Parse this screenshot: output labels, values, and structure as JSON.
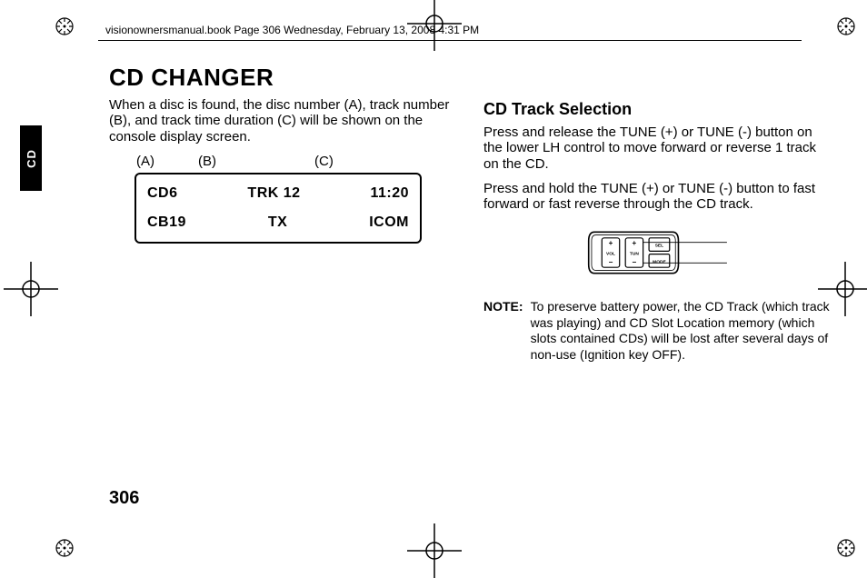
{
  "header": "visionownersmanual.book  Page 306  Wednesday, February 13, 2008  4:31 PM",
  "side_tab": "CD",
  "page_number": "306",
  "col1": {
    "title": "CD CHANGER",
    "intro": "When a disc is found, the disc number (A), track number (B), and track time duration (C) will be shown on the console display screen.",
    "labels": {
      "a": "(A)",
      "b": "(B)",
      "c": "(C)"
    },
    "display": {
      "r1a": "CD6",
      "r1b": "TRK 12",
      "r1c": "11:20",
      "r2a": "CB19",
      "r2b": "TX",
      "r2c": "ICOM"
    }
  },
  "col2": {
    "subtitle": "CD Track Selection",
    "p1": "Press and release the TUNE (+) or TUNE (-) button on the lower LH control to move forward or reverse 1 track on the CD.",
    "p2": "Press and hold the TUNE (+) or TUNE (-) button to fast forward or fast reverse through the CD track.",
    "control": {
      "vol_plus": "+",
      "vol": "VOL",
      "vol_minus": "−",
      "tun_plus": "+",
      "tun": "TUN",
      "tun_minus": "−",
      "sel": "SEL",
      "mode": "MODE"
    },
    "note_label": "NOTE:",
    "note_body": "To preserve battery power, the CD Track (which track was playing) and CD Slot Location memory (which slots contained CDs) will be lost after several days of non-use (Ignition key OFF)."
  }
}
